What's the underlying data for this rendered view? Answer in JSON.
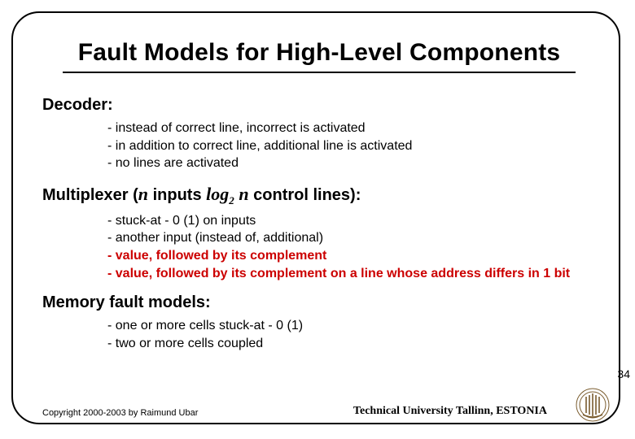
{
  "slide": {
    "title": "Fault Models for High-Level Components",
    "sections": {
      "decoder": {
        "heading": "Decoder:",
        "items": [
          "- instead of correct line, incorrect is activated",
          "- in addition to correct line, additional line is activated",
          "- no lines are activated"
        ]
      },
      "multiplexer": {
        "heading_prefix": "Multiplexer (",
        "n": "n",
        "mid1": "  inputs  ",
        "log": "log",
        "sub": "2",
        "space": " ",
        "n2": "n",
        "mid2": "  control lines):",
        "items_plain": [
          "- stuck-at - 0 (1) on inputs",
          "- another input (instead of, additional)"
        ],
        "items_red": [
          "- value, followed by its complement",
          "- value, followed by its complement on a line whose address differs in 1 bit"
        ]
      },
      "memory": {
        "heading": "Memory fault models:",
        "items": [
          "- one or more cells stuck-at - 0 (1)",
          "- two or more cells coupled"
        ]
      }
    },
    "page_number": "34",
    "footer": {
      "copyright": "Copyright 2000-2003 by Raimund Ubar",
      "affiliation": "Technical University Tallinn, ESTONIA"
    }
  }
}
